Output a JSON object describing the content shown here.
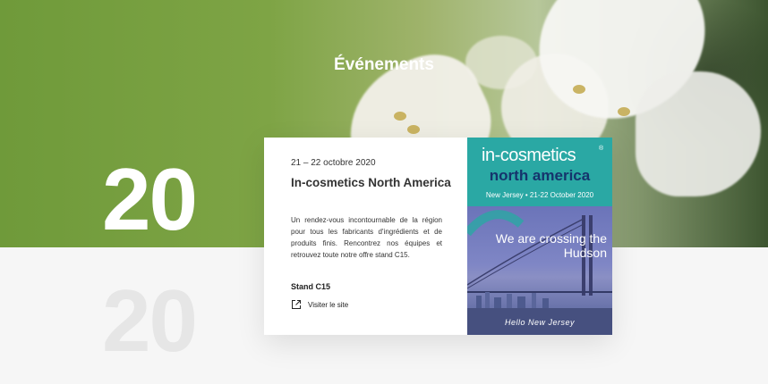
{
  "section": {
    "title": "Événements"
  },
  "year": "20",
  "year_bottom": "20",
  "event": {
    "date": "21 – 22 octobre 2020",
    "title": "In-cosmetics North America",
    "description": "Un rendez-vous incontournable de la région pour tous les fabricants d'ingrédients et de produits finis. Rencontrez nos équipes et retrouvez toute notre offre stand C15.",
    "stand": "Stand C15",
    "link_label": "Visiter le site",
    "link_icon": "external-link-icon"
  },
  "event_image": {
    "logo_line1": "in-cosmetics",
    "logo_line2": "north america",
    "registered": "®",
    "location": "New Jersey • 21-22 October 2020",
    "tagline": "We are crossing the Hudson",
    "hello": "Hello New Jersey",
    "colors": {
      "teal": "#2aa8a4",
      "navy": "#15346c"
    }
  }
}
